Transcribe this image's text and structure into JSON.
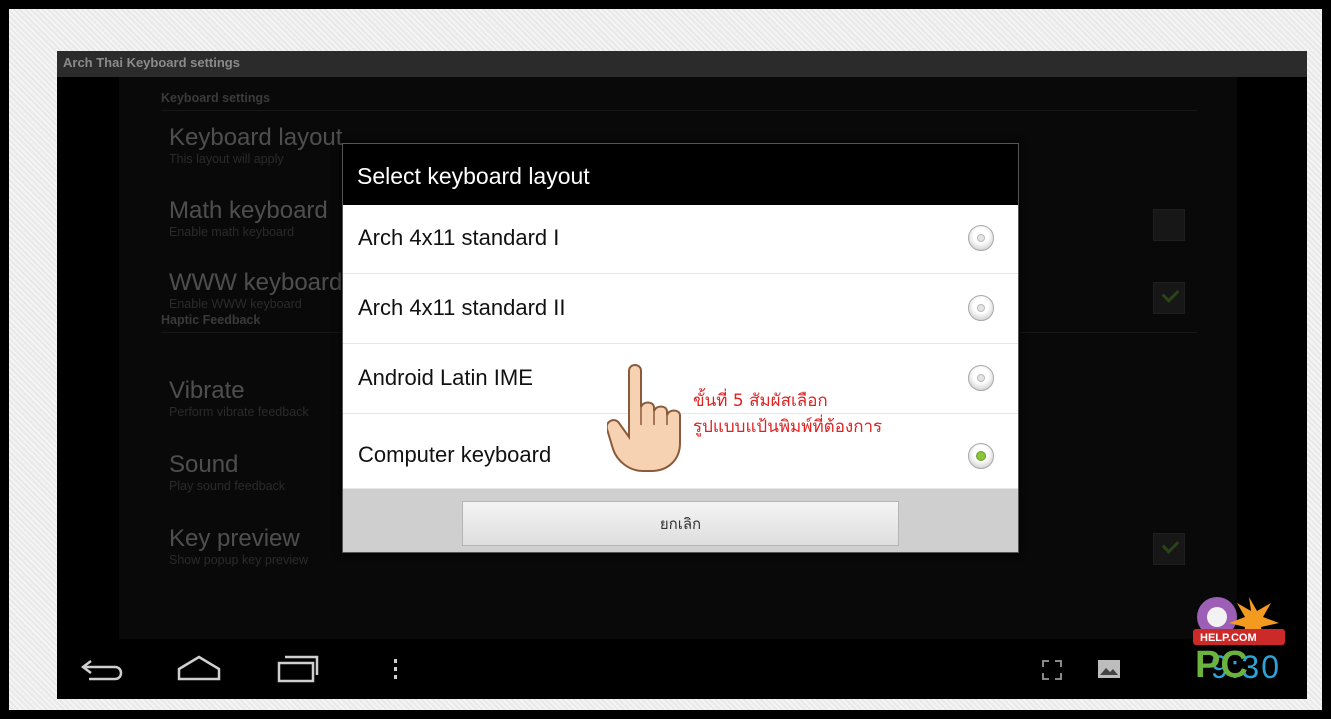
{
  "window": {
    "title": "Arch Thai Keyboard settings"
  },
  "sections": {
    "keyboard": "Keyboard settings",
    "haptic": "Haptic Feedback"
  },
  "prefs": [
    {
      "title": "Keyboard layout",
      "subtitle": "This layout will apply"
    },
    {
      "title": "Math keyboard",
      "subtitle": "Enable math keyboard",
      "checked": false
    },
    {
      "title": "WWW keyboard",
      "subtitle": "Enable WWW keyboard",
      "checked": true
    },
    {
      "title": "Vibrate",
      "subtitle": "Perform vibrate feedback"
    },
    {
      "title": "Sound",
      "subtitle": "Play sound feedback"
    },
    {
      "title": "Key preview",
      "subtitle": "Show popup key preview",
      "checked": true
    }
  ],
  "dialog": {
    "title": "Select keyboard layout",
    "options": [
      {
        "label": "Arch 4x11 standard I",
        "selected": false
      },
      {
        "label": "Arch 4x11 standard II",
        "selected": false
      },
      {
        "label": "Android Latin IME",
        "selected": false
      },
      {
        "label": "Computer keyboard",
        "selected": true
      }
    ],
    "cancel_label": "ยกเลิก"
  },
  "annotation": {
    "line1": "ขั้นที่ 5 สัมผัสเลือก",
    "line2": "รูปแบบแป้นพิมพ์ที่ต้องการ"
  },
  "statusbar": {
    "clock": "9:30"
  },
  "logo": {
    "text_top": "HELP.COM",
    "text_main": "PC",
    "brand_prefix": "o"
  },
  "icons": [
    "back-icon",
    "home-icon",
    "recent-apps-icon",
    "menu-icon",
    "fullscreen-icon",
    "gallery-icon"
  ]
}
